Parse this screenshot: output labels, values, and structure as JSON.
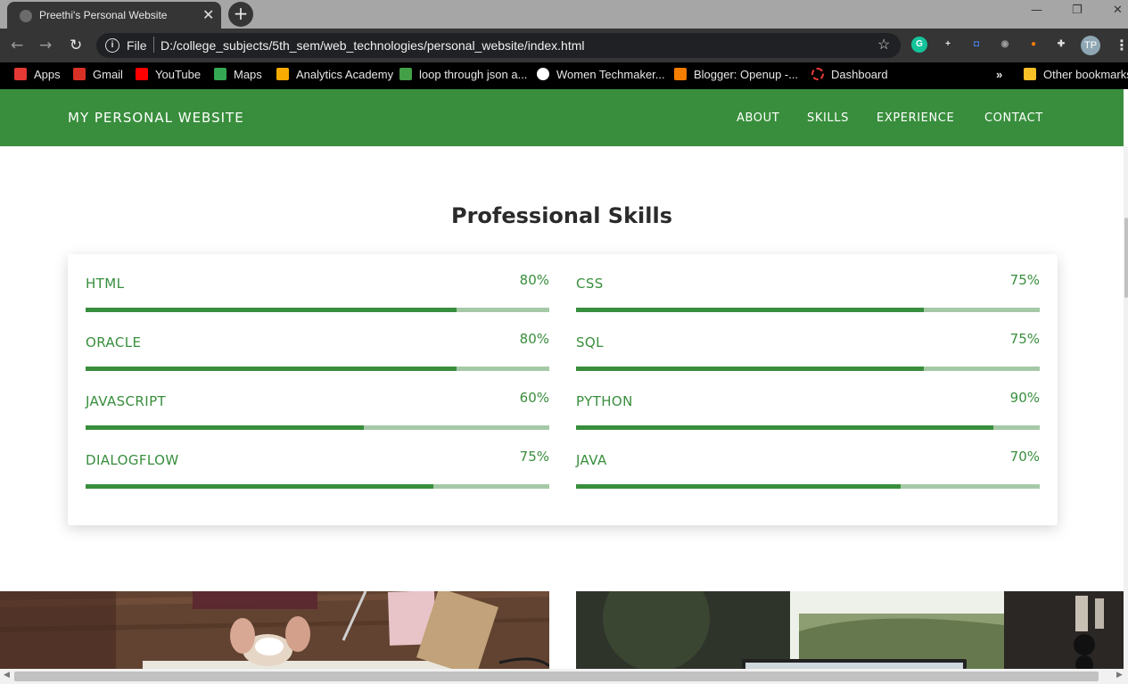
{
  "browser": {
    "tab_title": "Preethi's Personal Website",
    "tab_close": "✕",
    "new_tab": "+",
    "window_controls": {
      "minimize": "—",
      "restore": "❐",
      "close": "✕"
    },
    "nav": {
      "back": "←",
      "forward": "→",
      "reload": "↻"
    },
    "address": {
      "scheme": "File",
      "url": "D:/college_subjects/5th_sem/web_technologies/personal_website/index.html",
      "info": "i"
    },
    "star": "☆",
    "extensions": [
      {
        "name": "grammarly-icon",
        "label": "G",
        "color": "#15c39a"
      },
      {
        "name": "extension-plus-icon",
        "label": "+",
        "color": "#e8e8e8"
      },
      {
        "name": "extension-blue-icon",
        "label": "◘",
        "color": "#4a8af4"
      },
      {
        "name": "camera-icon",
        "label": "◉",
        "color": "#9e9e9e"
      },
      {
        "name": "extension-orange-icon",
        "label": "●",
        "color": "#f57c00"
      },
      {
        "name": "puzzle-icon",
        "label": "✚",
        "color": "#e0e0e0"
      }
    ],
    "profile_initials": "TP",
    "menu": "⋮",
    "bookmarks": [
      {
        "label": "Apps",
        "icon": "apps-grid-icon",
        "color": "#e53935"
      },
      {
        "label": "Gmail",
        "icon": "gmail-icon",
        "color": "#d93025"
      },
      {
        "label": "YouTube",
        "icon": "youtube-icon",
        "color": "#ff0000"
      },
      {
        "label": "Maps",
        "icon": "maps-icon",
        "color": "#34a853"
      },
      {
        "label": "Analytics Academy",
        "icon": "analytics-icon",
        "color": "#f9ab00"
      },
      {
        "label": "loop through json a...",
        "icon": "loop-icon",
        "color": "#43a047"
      },
      {
        "label": "Women Techmaker...",
        "icon": "globe-icon",
        "color": "#ffffff"
      },
      {
        "label": "Blogger: Openup -...",
        "icon": "blogger-icon",
        "color": "#f57d00"
      },
      {
        "label": "Dashboard",
        "icon": "dashboard-icon",
        "color": "#e53935"
      }
    ],
    "bookmarks_overflow": "»",
    "other_bookmarks": "Other bookmarks"
  },
  "site": {
    "brand": "MY PERSONAL WEBSITE",
    "nav_links": [
      "ABOUT",
      "SKILLS",
      "EXPERIENCE",
      "CONTACT"
    ],
    "accent_color": "#388e3c",
    "track_color": "#a5c9a7"
  },
  "skills_section": {
    "heading": "Professional Skills",
    "skills": [
      {
        "name": "HTML",
        "percent_label": "80%",
        "level": 0.8
      },
      {
        "name": "CSS",
        "percent_label": "75%",
        "level": 0.75
      },
      {
        "name": "ORACLE",
        "percent_label": "80%",
        "level": 0.8
      },
      {
        "name": "SQL",
        "percent_label": "75%",
        "level": 0.75
      },
      {
        "name": "JAVASCRIPT",
        "percent_label": "60%",
        "level": 0.6
      },
      {
        "name": "PYTHON",
        "percent_label": "90%",
        "level": 0.9
      },
      {
        "name": "DIALOGFLOW",
        "percent_label": "75%",
        "level": 0.75
      },
      {
        "name": "JAVA",
        "percent_label": "70%",
        "level": 0.7
      }
    ]
  }
}
